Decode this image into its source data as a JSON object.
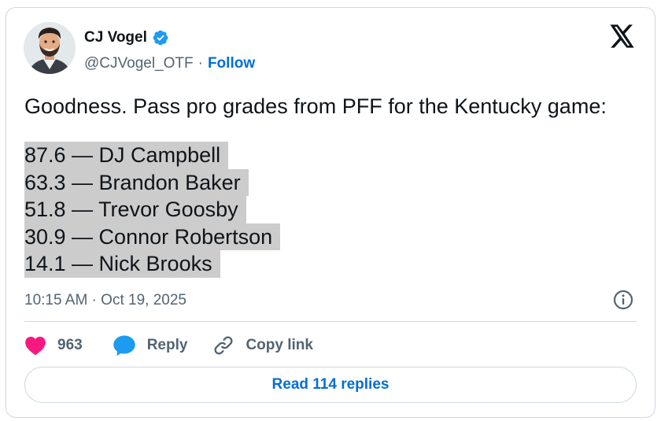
{
  "author": {
    "display_name": "CJ Vogel",
    "handle": "@CJVogel_OTF",
    "separator": "·",
    "follow_label": "Follow",
    "verified": true
  },
  "tweet": {
    "text": "Goodness. Pass pro grades from PFF for the Kentucky game:",
    "grades": [
      "87.6 — DJ Campbell",
      "63.3 — Brandon Baker",
      "51.8 — Trevor Goosby",
      "30.9 — Connor Robertson",
      "14.1 — Nick Brooks"
    ],
    "timestamp": "10:15 AM · Oct 19, 2025"
  },
  "actions": {
    "like_count": "963",
    "reply_label": "Reply",
    "copy_label": "Copy link"
  },
  "read_replies_label": "Read 114 replies",
  "colors": {
    "accent": "#006fd6",
    "like": "#f91880",
    "reply": "#1d9bf0",
    "highlight": "#cccccc"
  },
  "icons": [
    "verified-badge-icon",
    "x-logo-icon",
    "info-icon",
    "heart-icon",
    "reply-bubble-icon",
    "link-icon"
  ]
}
